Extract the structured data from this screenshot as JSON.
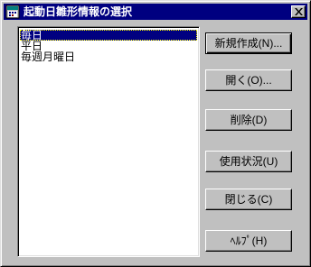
{
  "window": {
    "title": "起動日雛形情報の選択",
    "icon": "calendar-app-icon",
    "close_icon": "close-icon"
  },
  "list": {
    "items": [
      {
        "label": "毎日",
        "selected": true
      },
      {
        "label": "平日",
        "selected": false
      },
      {
        "label": "毎週月曜日",
        "selected": false
      }
    ]
  },
  "buttons": {
    "new": "新規作成(N)...",
    "open": "開く(O)...",
    "delete": "削除(D)",
    "usage": "使用状況(U)",
    "close": "閉じる(C)",
    "help": "ﾍﾙﾌﾟ(H)"
  },
  "colors": {
    "titlebar": "#000080",
    "face": "#c0c0c0",
    "selection": "#000080"
  }
}
